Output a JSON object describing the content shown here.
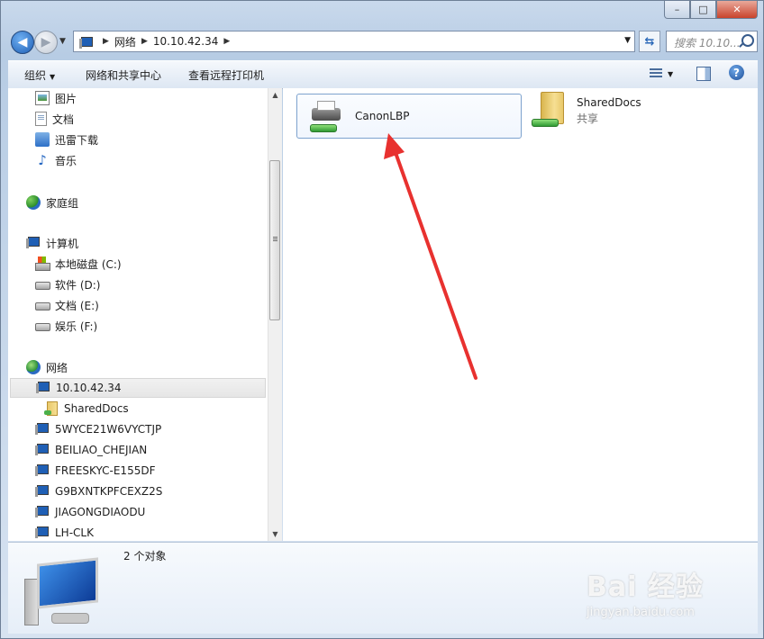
{
  "window": {
    "caption_buttons": {
      "minimize": "–",
      "maximize": "□",
      "close": "✕"
    }
  },
  "nav": {
    "back_icon": "back-arrow-icon",
    "forward_icon": "forward-arrow-icon",
    "breadcrumb": [
      "网络",
      "10.10.42.34"
    ],
    "search_placeholder": "搜索 10.10..."
  },
  "command_bar": {
    "organize": "组织",
    "network_center": "网络和共享中心",
    "view_printers": "查看远程打印机"
  },
  "sidebar": {
    "items": [
      {
        "label": "图片",
        "icon": "pictures-icon"
      },
      {
        "label": "文档",
        "icon": "documents-icon"
      },
      {
        "label": "迅雷下载",
        "icon": "downloads-icon"
      },
      {
        "label": "音乐",
        "icon": "music-icon"
      },
      {
        "label": "家庭组",
        "icon": "homegroup-icon"
      },
      {
        "label": "计算机",
        "icon": "computer-icon"
      },
      {
        "label": "本地磁盘 (C:)",
        "icon": "drive-c-icon"
      },
      {
        "label": "软件 (D:)",
        "icon": "drive-icon"
      },
      {
        "label": "文档 (E:)",
        "icon": "drive-icon"
      },
      {
        "label": "娱乐 (F:)",
        "icon": "drive-icon"
      },
      {
        "label": "网络",
        "icon": "network-icon"
      },
      {
        "label": "10.10.42.34",
        "icon": "computer-icon"
      },
      {
        "label": "SharedDocs",
        "icon": "shared-folder-icon"
      },
      {
        "label": "5WYCE21W6VYCTJP",
        "icon": "computer-icon"
      },
      {
        "label": "BEILIAO_CHEJIAN",
        "icon": "computer-icon"
      },
      {
        "label": "FREESKYC-E155DF",
        "icon": "computer-icon"
      },
      {
        "label": "G9BXNTKPFCEXZ2S",
        "icon": "computer-icon"
      },
      {
        "label": "JIAGONGDIAODU",
        "icon": "computer-icon"
      },
      {
        "label": "LH-CLK",
        "icon": "computer-icon"
      }
    ],
    "selected": "10.10.42.34"
  },
  "content": {
    "items": [
      {
        "name": "CanonLBP",
        "subtitle": "",
        "icon": "shared-printer-icon",
        "selected": true
      },
      {
        "name": "SharedDocs",
        "subtitle": "共享",
        "icon": "shared-folder-icon",
        "selected": false
      }
    ]
  },
  "details": {
    "count": "2 个对象"
  },
  "watermark": {
    "brand": "Bai 经验",
    "url": "jingyan.baidu.com"
  },
  "colors": {
    "annotation_arrow": "#e8312f",
    "selection_border": "#7da2ce"
  }
}
